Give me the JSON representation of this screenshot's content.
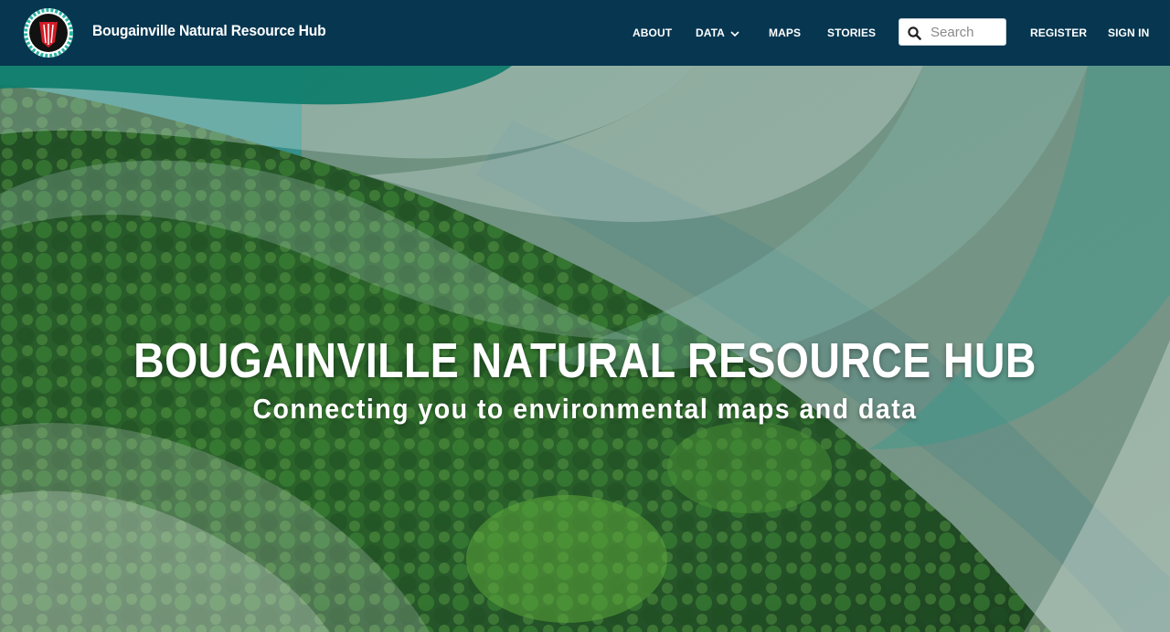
{
  "header": {
    "site_title": "Bougainville Natural Resource Hub",
    "logo_icon": "bougainville-emblem-icon",
    "bg_color": "#063650"
  },
  "nav": {
    "about": "ABOUT",
    "data": "DATA",
    "maps": "MAPS",
    "stories": "STORIES",
    "register": "REGISTER",
    "sign_in": "SIGN IN"
  },
  "search": {
    "placeholder": "Search",
    "value": "",
    "icon": "search-icon"
  },
  "hero": {
    "title": "BOUGAINVILLE NATURAL RESOURCE HUB",
    "subtitle": "Connecting you to environmental maps and data",
    "accent_color": "#1a9a8a"
  }
}
